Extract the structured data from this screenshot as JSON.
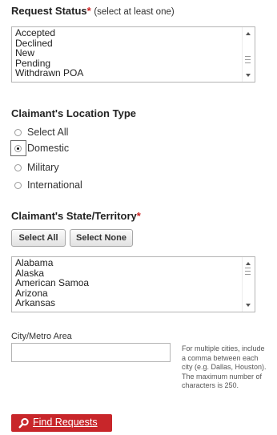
{
  "request_status": {
    "title": "Request Status",
    "required_mark": "*",
    "hint": "(select at least one)",
    "options": [
      "Accepted",
      "Declined",
      "New",
      "Pending",
      "Withdrawn POA"
    ]
  },
  "location_type": {
    "title": "Claimant's Location Type",
    "options": [
      {
        "label": "Select All",
        "checked": false
      },
      {
        "label": "Domestic",
        "checked": true
      },
      {
        "label": "Military",
        "checked": false
      },
      {
        "label": "International",
        "checked": false
      }
    ]
  },
  "state": {
    "title": "Claimant's State/Territory",
    "required_mark": "*",
    "select_all_label": "Select All",
    "select_none_label": "Select None",
    "options": [
      "Alabama",
      "Alaska",
      "American Samoa",
      "Arizona",
      "Arkansas"
    ]
  },
  "city": {
    "label": "City/Metro Area",
    "value": "",
    "help_lines": [
      "For multiple cities, include",
      "a comma between each",
      "city (e.g. Dallas, Houston).",
      "The maximum number of",
      "characters is 250."
    ]
  },
  "find_button": {
    "label": "Find Requests",
    "icon": "magnifier-icon"
  },
  "colors": {
    "required": "#cc1f1f",
    "find_button_bg": "#c8262a"
  }
}
